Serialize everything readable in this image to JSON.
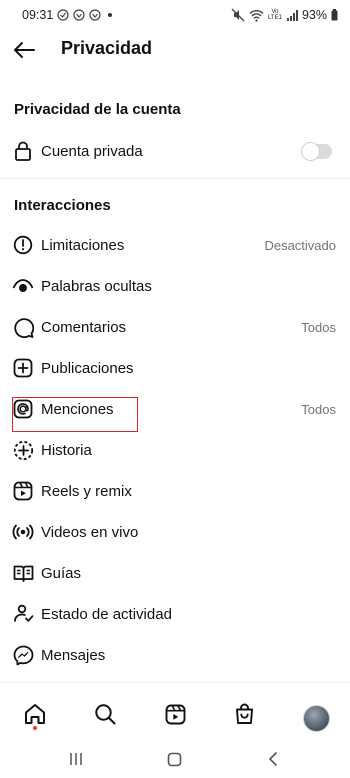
{
  "status_bar": {
    "time": "09:31",
    "battery": "93%",
    "carrier": "Vo LTE1"
  },
  "header": {
    "title": "Privacidad",
    "back_icon": "arrow-left-icon"
  },
  "account_privacy": {
    "section_title": "Privacidad de la cuenta",
    "private_account": {
      "label": "Cuenta privada",
      "icon": "lock-icon",
      "toggle_on": false
    }
  },
  "interactions": {
    "section_title": "Interacciones",
    "items": [
      {
        "label": "Limitaciones",
        "value": "Desactivado",
        "icon": "limit-icon"
      },
      {
        "label": "Palabras ocultas",
        "value": "",
        "icon": "hidden-eye-icon"
      },
      {
        "label": "Comentarios",
        "value": "Todos",
        "icon": "comment-icon"
      },
      {
        "label": "Publicaciones",
        "value": "",
        "icon": "plus-square-icon"
      },
      {
        "label": "Menciones",
        "value": "Todos",
        "icon": "at-icon"
      },
      {
        "label": "Historia",
        "value": "",
        "icon": "story-add-icon"
      },
      {
        "label": "Reels y remix",
        "value": "",
        "icon": "reels-icon"
      },
      {
        "label": "Videos en vivo",
        "value": "",
        "icon": "live-icon"
      },
      {
        "label": "Guías",
        "value": "",
        "icon": "guide-icon"
      },
      {
        "label": "Estado de actividad",
        "value": "",
        "icon": "activity-status-icon"
      },
      {
        "label": "Mensajes",
        "value": "",
        "icon": "messenger-icon"
      }
    ]
  },
  "bottom_nav": {
    "items": [
      "home-icon",
      "search-icon",
      "reels-icon",
      "shop-icon",
      "profile-avatar"
    ]
  },
  "colors": {
    "highlight": "#d9262c",
    "secondary_text": "#737373",
    "notification_dot": "#ff3040"
  }
}
